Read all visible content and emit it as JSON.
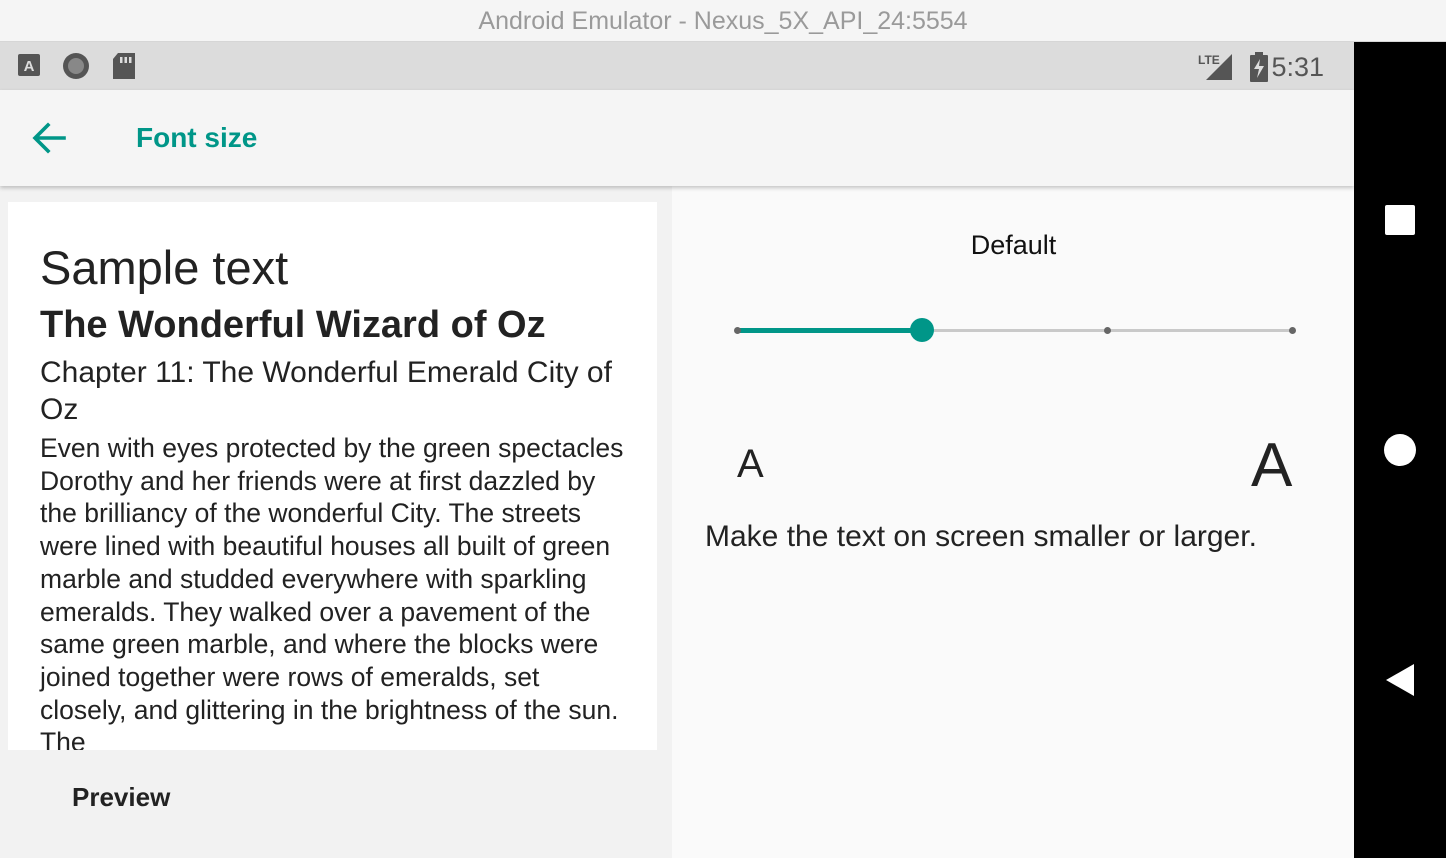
{
  "window": {
    "title": "Android Emulator - Nexus_5X_API_24:5554"
  },
  "status_bar": {
    "time": "5:31",
    "left_icons": [
      "android-a-icon",
      "record-circle-icon",
      "sd-card-icon"
    ],
    "right_icons": [
      "lte-signal-icon",
      "battery-charging-icon"
    ]
  },
  "app_bar": {
    "title": "Font size",
    "back_icon": "arrow-back-icon",
    "accent_color": "#009688"
  },
  "preview": {
    "sample_heading": "Sample text",
    "book_title": "The Wonderful Wizard of Oz",
    "chapter": "Chapter 11: The Wonderful Emerald City of Oz",
    "body": "Even with eyes protected by the green spectacles Dorothy and her friends were at first dazzled by the brilliancy of the wonderful City. The streets were lined with beautiful houses all built of green marble and studded everywhere with sparkling emeralds. They walked over a pavement of the same green marble, and where the blocks were joined together were rows of emeralds, set closely, and glittering in the brightness of the sun. The",
    "label": "Preview"
  },
  "font_size": {
    "current_label": "Default",
    "steps": 4,
    "selected_index": 1,
    "small_glyph": "A",
    "large_glyph": "A",
    "description": "Make the text on screen smaller or larger."
  },
  "nav_bar": {
    "buttons": [
      "recents-square-icon",
      "home-circle-icon",
      "back-triangle-icon"
    ]
  }
}
